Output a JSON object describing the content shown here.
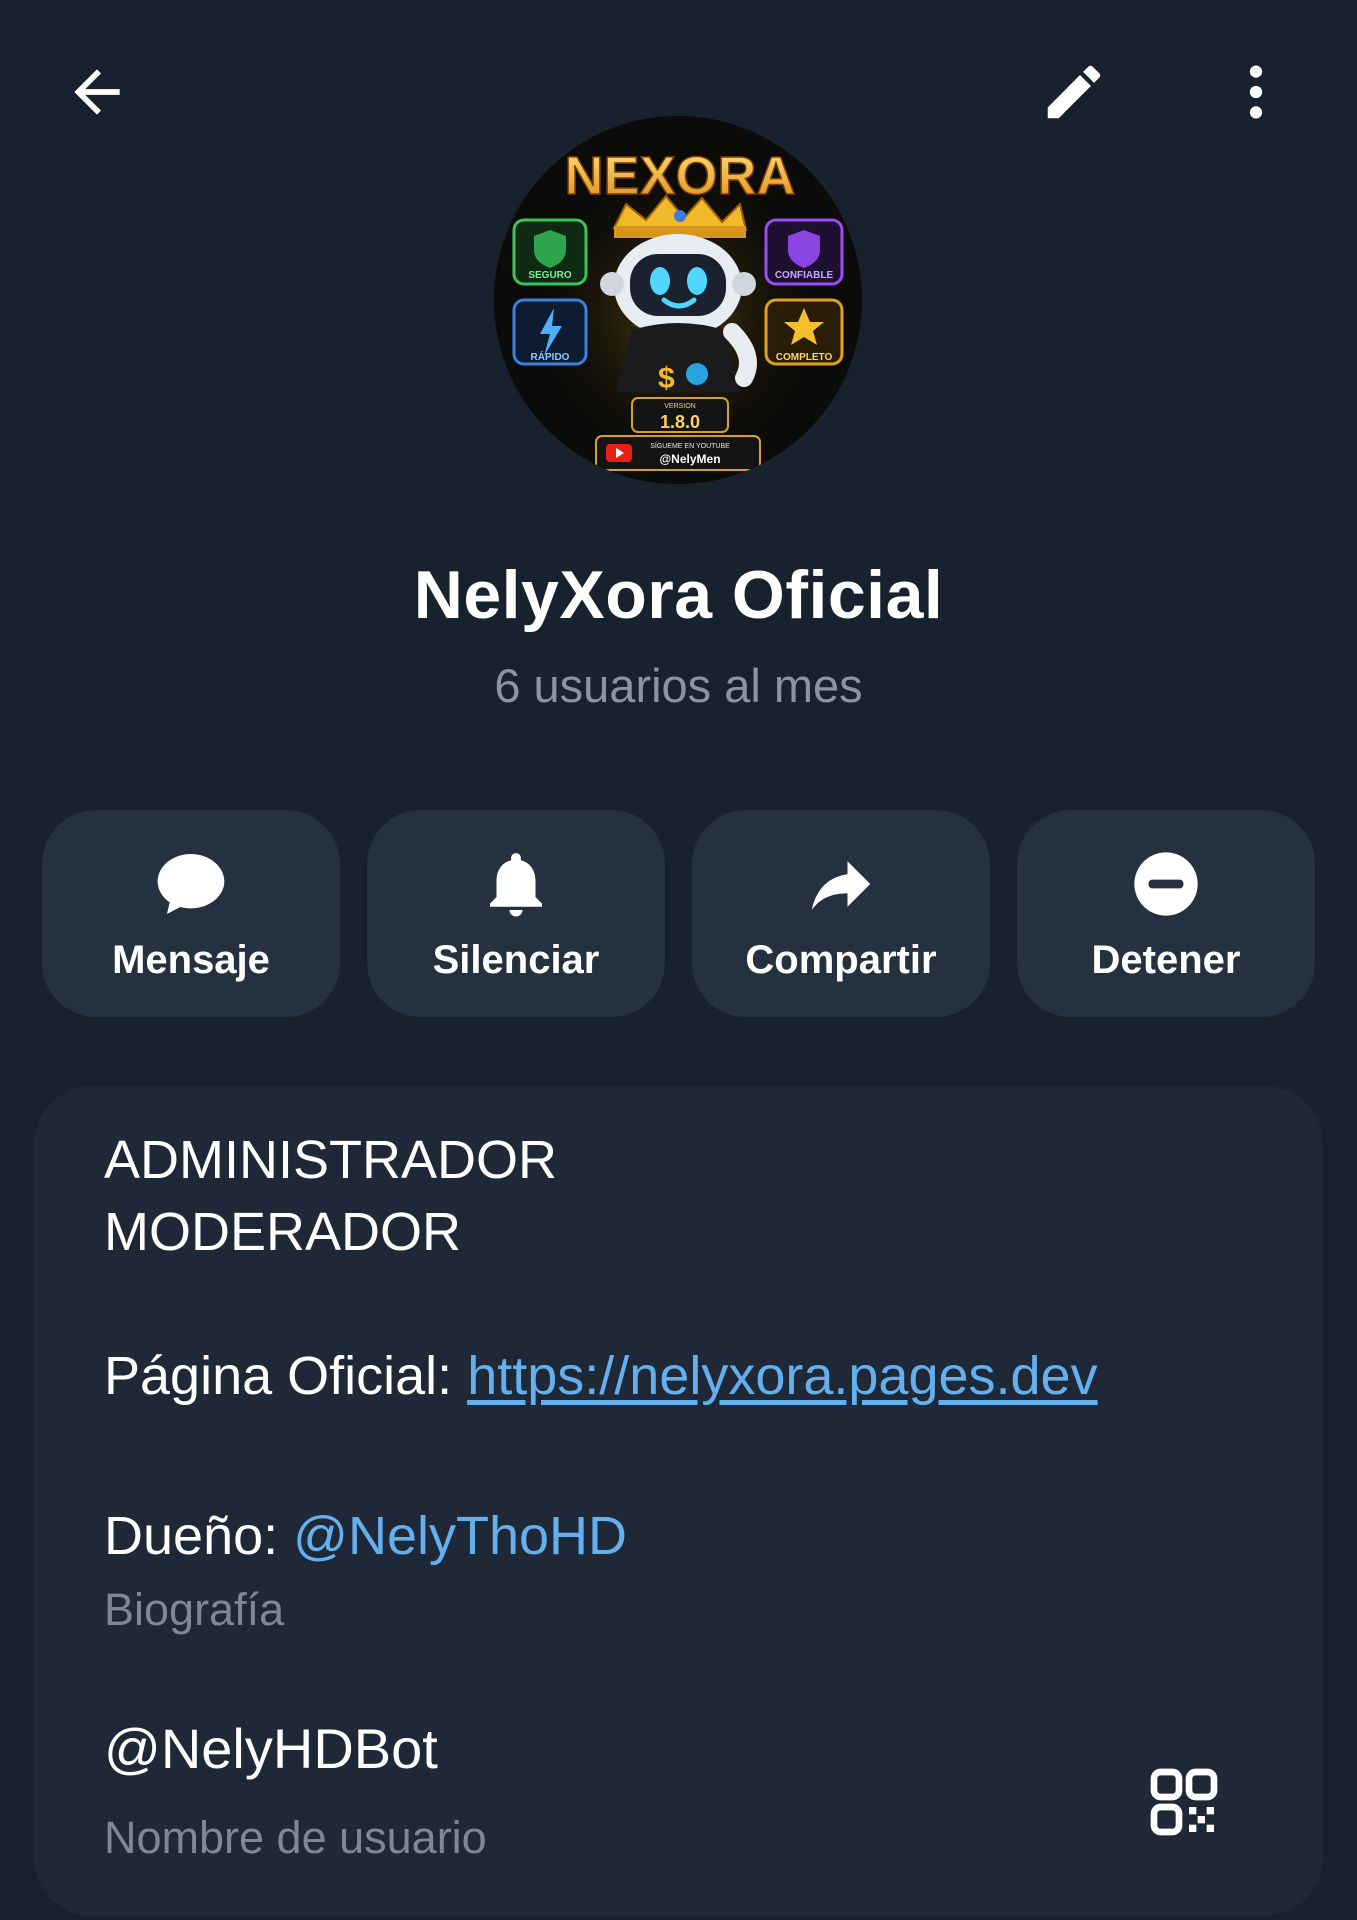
{
  "topbar": {
    "back_icon": "arrow-left-icon",
    "edit_icon": "pencil-icon",
    "more_icon": "more-vertical-icon"
  },
  "avatar": {
    "brand": "NEXORA",
    "badges": [
      "SEGURO",
      "CONFIABLE",
      "RÁPIDO",
      "COMPLETO"
    ],
    "version_label": "VERSION",
    "version": "1.8.0",
    "youtube_caption": "SÍGUEME EN YOUTUBE",
    "youtube_handle": "@NelyMen"
  },
  "profile": {
    "name": "NelyXora Oficial",
    "subtitle": "6 usuarios al mes"
  },
  "actions": [
    {
      "label": "Mensaje",
      "icon": "message-bubble-icon"
    },
    {
      "label": "Silenciar",
      "icon": "bell-icon"
    },
    {
      "label": "Compartir",
      "icon": "share-arrow-icon"
    },
    {
      "label": "Detener",
      "icon": "block-icon"
    }
  ],
  "info": {
    "bio_line1": "ADMINISTRADOR",
    "bio_line2": "MODERADOR",
    "page_label": "Página Oficial: ",
    "page_url": "https://nelyxora.pages.dev",
    "owner_label": "Dueño: ",
    "owner_handle": "@NelyThoHD",
    "bio_caption": "Biografía",
    "username": "@NelyHDBot",
    "username_caption": "Nombre de usuario",
    "qr_icon": "qr-code-icon"
  },
  "colors": {
    "background": "#18222f",
    "card": "#1e2836",
    "button": "#25313f",
    "link": "#64b0ee",
    "muted": "#8a95a2"
  }
}
